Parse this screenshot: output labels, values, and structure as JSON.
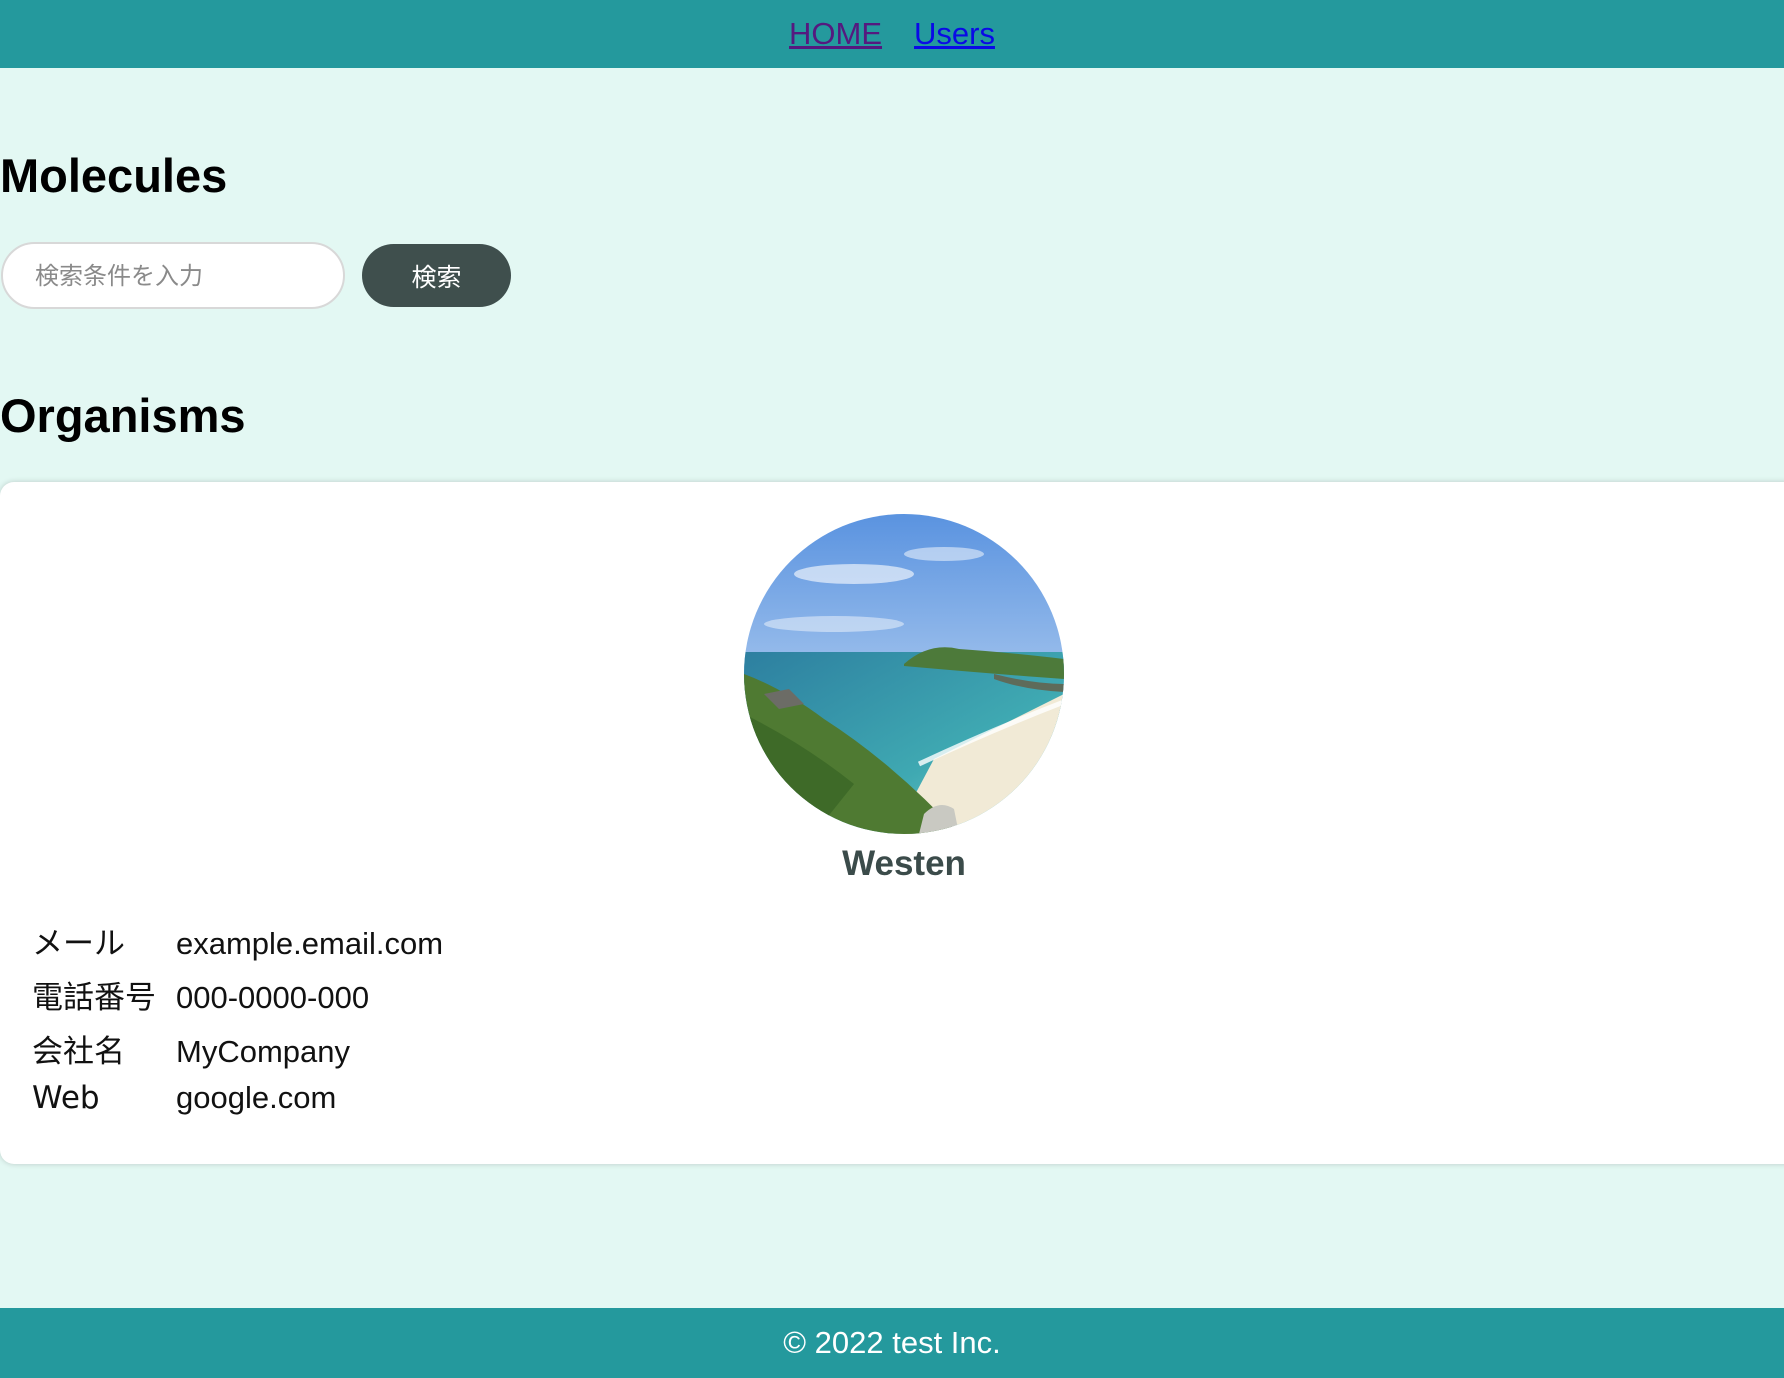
{
  "nav": {
    "home_label": "HOME",
    "users_label": "Users"
  },
  "sections": {
    "molecules_title": "Molecules",
    "organisms_title": "Organisms"
  },
  "search": {
    "placeholder": "検索条件を入力",
    "value": "",
    "button_label": "検索"
  },
  "user_card": {
    "avatar_icon": "landscape-photo",
    "name": "Westen",
    "details": [
      {
        "label": "メール",
        "value": "example.email.com"
      },
      {
        "label": "電話番号",
        "value": "000-0000-000"
      },
      {
        "label": "会社名",
        "value": "MyCompany"
      },
      {
        "label": "Web",
        "value": "google.com"
      }
    ]
  },
  "footer": {
    "copyright": "© 2022 test Inc."
  },
  "colors": {
    "header_bg": "#24999d",
    "page_bg": "#e3f8f3",
    "button_bg": "#3f4f4d",
    "name_color": "#3b4b4a"
  }
}
